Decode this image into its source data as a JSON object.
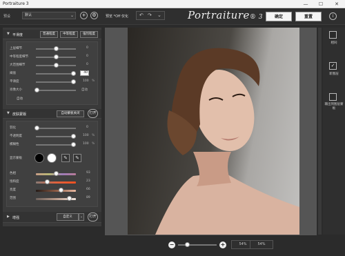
{
  "window": {
    "title": "Portraiture 3",
    "controls": [
      "—",
      "☐",
      "✕"
    ]
  },
  "toolbar": {
    "preset_label": "预设",
    "preset_value": "默认",
    "add_icon": "plus-icon",
    "settings_icon": "gear-icon",
    "preview_label": "预览 *Off 仅化",
    "logo": "Portraiture",
    "logo_version": "® 3",
    "ok_label": "确定",
    "reset_label": "重置",
    "info_icon": "info-icon"
  },
  "smoothing": {
    "title": "平滑度",
    "buttons": [
      "普通程度",
      "中等程度",
      "强烈程度"
    ],
    "sliders": [
      {
        "label": "上层细节",
        "value": "0",
        "unit": "",
        "level": 0.5
      },
      {
        "label": "中等程度细节",
        "value": "0",
        "unit": "",
        "level": 0.5
      },
      {
        "label": "大范围细节",
        "value": "0",
        "unit": "",
        "level": 0.5
      },
      {
        "label": "阈值",
        "value": "40",
        "unit": "",
        "level": 0.95
      },
      {
        "label": "平滑度",
        "value": "100",
        "unit": "%",
        "level": 0.95
      },
      {
        "label": "肖像大小",
        "value": "自动",
        "unit": "",
        "level": 0.0
      }
    ],
    "note": "自动"
  },
  "skin_mask": {
    "title": "皮肤蒙版",
    "auto_button": "自动蒙板关闭",
    "toggle": "打开",
    "sliders": [
      {
        "label": "羽化",
        "value": "0",
        "unit": "",
        "level": 0.0
      },
      {
        "label": "不透明度",
        "value": "100",
        "unit": "%",
        "level": 0.95
      },
      {
        "label": "模糊性",
        "value": "100",
        "unit": "%",
        "level": 0.95
      }
    ],
    "show_mask_label": "显示蒙板",
    "color_sliders": [
      {
        "label": "色相",
        "value": "93",
        "level": 0.55
      },
      {
        "label": "饱和度",
        "value": "23",
        "level": 0.3
      },
      {
        "label": "亮度",
        "value": "66",
        "level": 0.6
      },
      {
        "label": "范围",
        "value": "89",
        "level": 0.92
      }
    ]
  },
  "enhance": {
    "title": "增强",
    "select_value": "自定义",
    "toggle": "打开"
  },
  "right_panel": {
    "items": [
      "相同",
      "新图层",
      "输出到图层蒙板"
    ]
  },
  "zoom": {
    "minus": "−",
    "plus": "+",
    "zoom_a": "54%",
    "zoom_b": "54%"
  },
  "colors": {
    "accent": "#f5f5f5",
    "panel": "#3a3a3a",
    "bg": "#2b2b2b"
  }
}
